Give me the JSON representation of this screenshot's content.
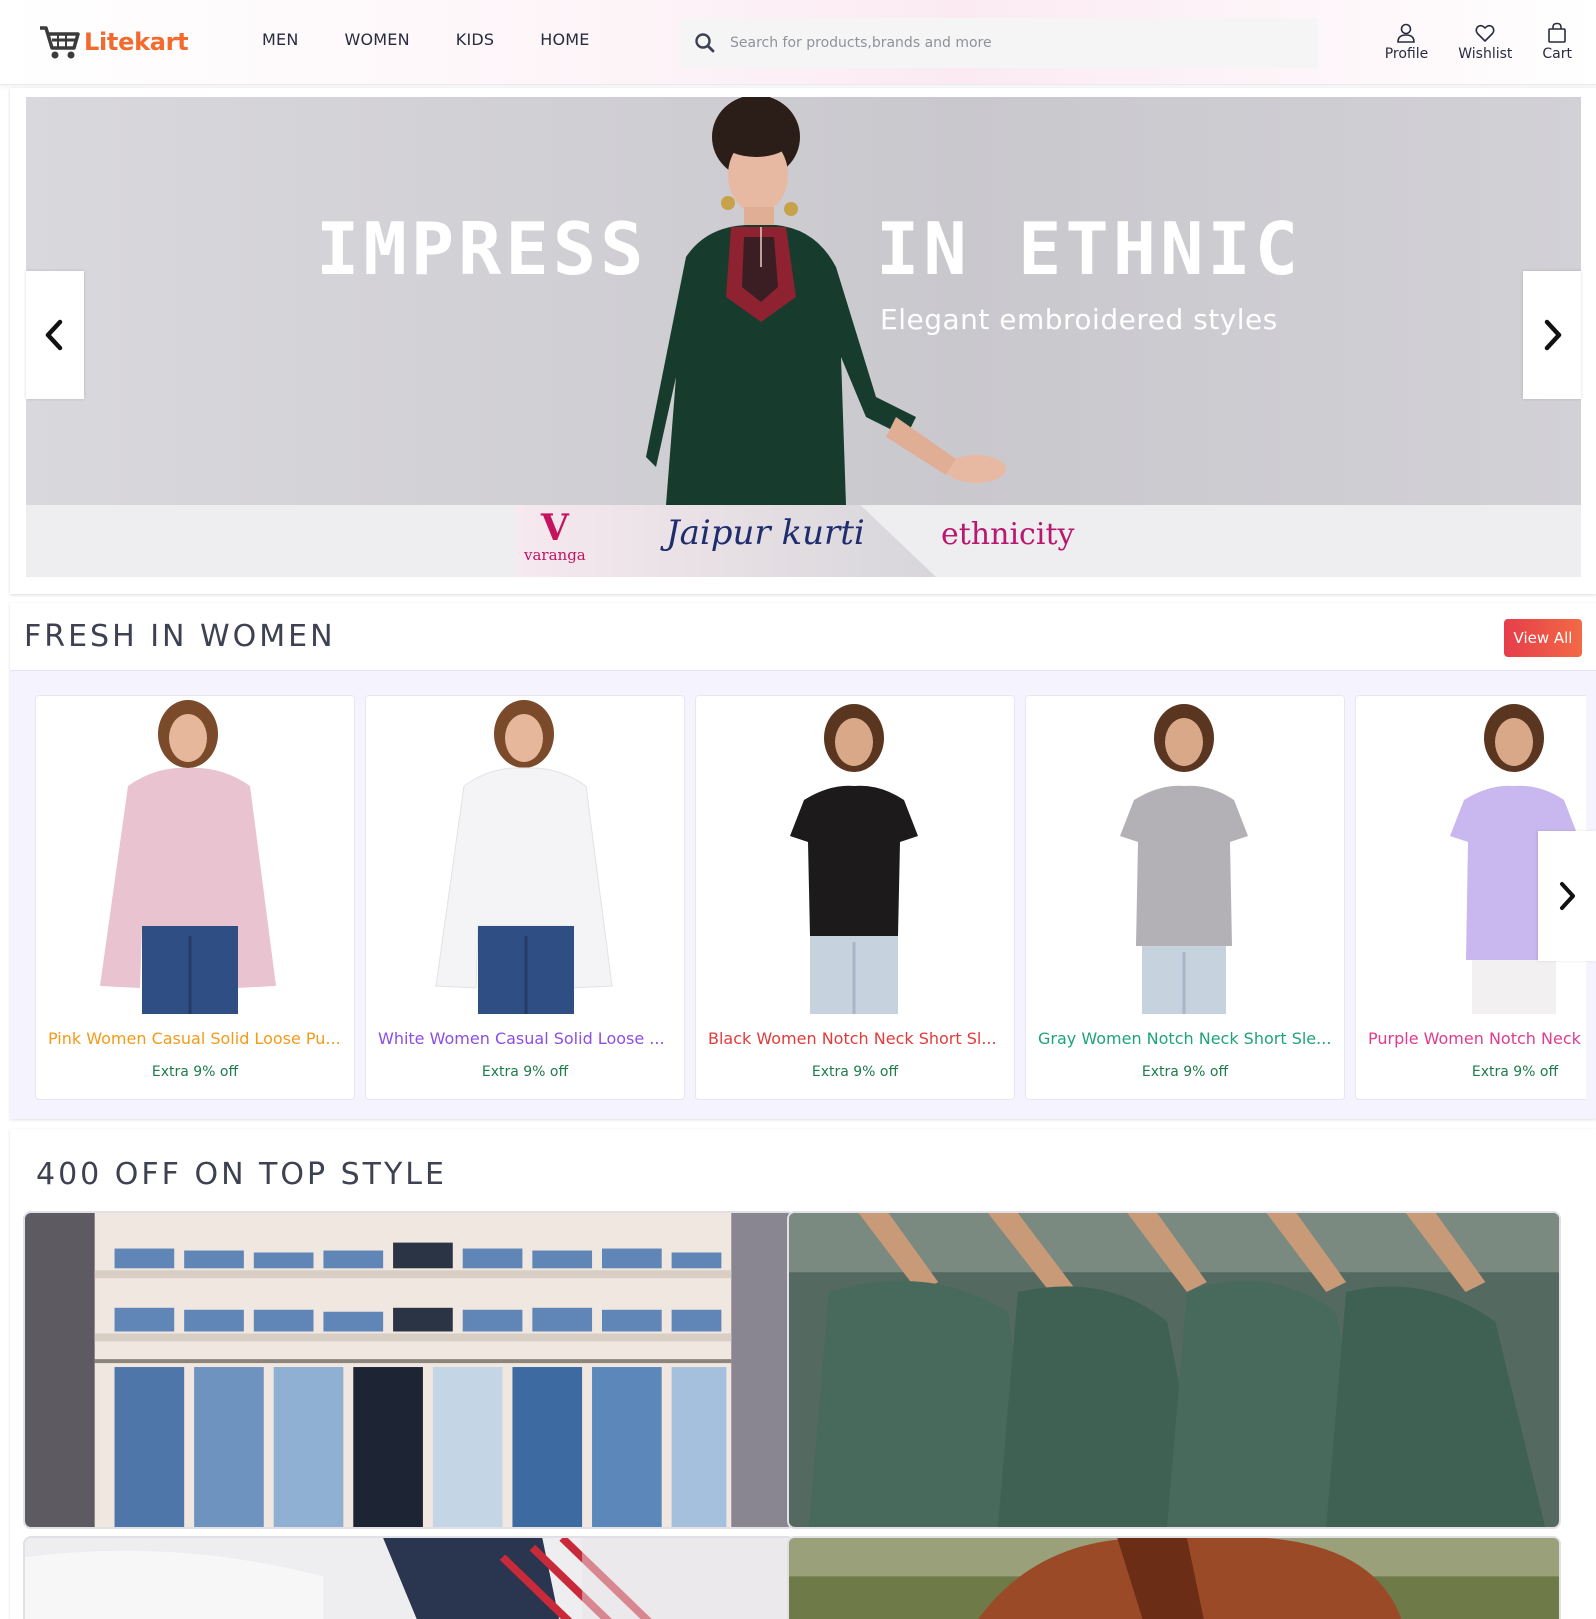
{
  "header": {
    "logo_text": "Litekart",
    "nav": [
      "MEN",
      "WOMEN",
      "KIDS",
      "HOME"
    ],
    "search_placeholder": "Search for products,brands and more",
    "actions": {
      "profile": "Profile",
      "wishlist": "Wishlist",
      "cart": "Cart"
    }
  },
  "banner": {
    "title_left": "IMPRESS",
    "title_right": "IN ETHNIC",
    "subtitle": "Elegant embroidered styles",
    "brands": {
      "varanga_mark": "V",
      "varanga": "varanga",
      "jaipur": "Jaipur kurti",
      "ethnicity": "ethnicity"
    }
  },
  "fresh_section": {
    "title": "FRESH IN WOMEN",
    "view_all": "View All",
    "products": [
      {
        "name": "Pink Women Casual Solid Loose Pu...",
        "offer": "Extra 9% off",
        "color": "#f49a17",
        "garment": "#e9c3cf"
      },
      {
        "name": "White Women Casual Solid Loose ...",
        "offer": "Extra 9% off",
        "color": "#8b4ee6",
        "garment": "#f4f4f6"
      },
      {
        "name": "Black Women Notch Neck Short Sl...",
        "offer": "Extra 9% off",
        "color": "#e53a3a",
        "garment": "#1c1a1b"
      },
      {
        "name": "Gray Women Notch Neck Short Sle...",
        "offer": "Extra 9% off",
        "color": "#1ea37a",
        "garment": "#b3b1b6"
      },
      {
        "name": "Purple Women Notch Neck Short Sleeve",
        "offer": "Extra 9% off",
        "color": "#e13b8d",
        "garment": "#c9b7ef"
      }
    ]
  },
  "offer_section": {
    "title": "400 OFF ON TOP STYLE"
  },
  "colors": {
    "brand_orange": "#f26a2e",
    "view_all_bg": "#e63d4a",
    "offer_green": "#1e7c4c"
  }
}
